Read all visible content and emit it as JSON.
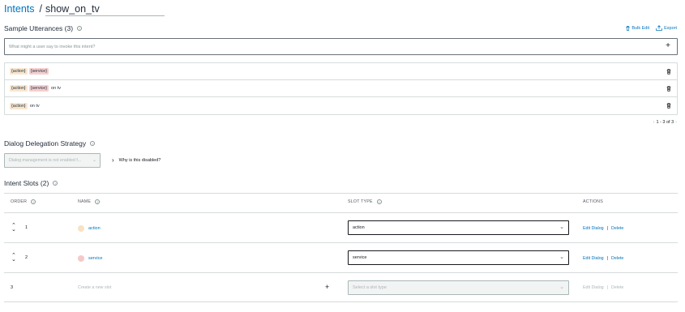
{
  "breadcrumb": {
    "parent": "Intents",
    "separator": "/",
    "intent_name": "show_on_tv"
  },
  "sample_utterances": {
    "title": "Sample Utterances (3)",
    "bulk_edit": "Bulk Edit",
    "export": "Export",
    "input_placeholder": "What might a user say to invoke this intent?",
    "rows": [
      {
        "chips": [
          "{action}",
          "{service}"
        ],
        "text": ""
      },
      {
        "chips": [
          "{action}",
          "{service}"
        ],
        "text": "on tv"
      },
      {
        "chips": [
          "{action}"
        ],
        "text": "on tv"
      }
    ],
    "pagination": "1 - 3 of 3"
  },
  "dialog_delegation": {
    "title": "Dialog Delegation Strategy",
    "select_value": "Dialog management is not enabled f...",
    "why_link": "Why is this disabled?"
  },
  "intent_slots": {
    "title": "Intent Slots (2)",
    "columns": {
      "order": "ORDER",
      "name": "NAME",
      "slot_type": "SLOT TYPE",
      "actions": "ACTIONS"
    },
    "rows": [
      {
        "order": "1",
        "name": "action",
        "slot_type": "action",
        "color": "#f8e2c4",
        "edit": "Edit Dialog",
        "sep": "|",
        "delete": "Delete"
      },
      {
        "order": "2",
        "name": "service",
        "slot_type": "service",
        "color": "#f5c9c9",
        "edit": "Edit Dialog",
        "sep": "|",
        "delete": "Delete"
      }
    ],
    "new_row": {
      "order": "3",
      "name_placeholder": "Create a new slot",
      "type_placeholder": "Select a slot type",
      "edit": "Edit Dialog",
      "sep": "|",
      "delete": "Delete"
    }
  },
  "colors": {
    "link": "#0073bb",
    "text": "#232f3e",
    "border": "#d5dbdb"
  }
}
